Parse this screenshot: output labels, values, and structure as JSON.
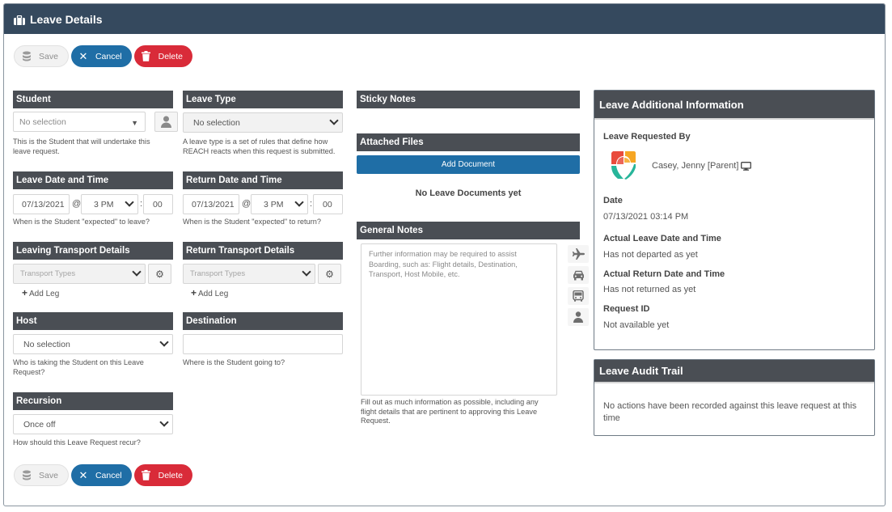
{
  "header": {
    "title": "Leave Details",
    "icon": "briefcase-icon"
  },
  "actions": {
    "save": "Save",
    "cancel": "Cancel",
    "delete": "Delete"
  },
  "student": {
    "heading": "Student",
    "value": "No selection",
    "help": "This is the Student that will undertake this leave request."
  },
  "leave_type": {
    "heading": "Leave Type",
    "value": "No selection",
    "help": "A leave type is a set of rules that define how REACH reacts when this request is submitted."
  },
  "leave_time": {
    "heading": "Leave Date and Time",
    "date": "07/13/2021",
    "at": "@",
    "hour": "3 PM",
    "sep": ":",
    "minute": "00",
    "help": "When is the Student \"expected\" to leave?"
  },
  "return_time": {
    "heading": "Return Date and Time",
    "date": "07/13/2021",
    "at": "@",
    "hour": "3 PM",
    "sep": ":",
    "minute": "00",
    "help": "When is the Student \"expected\" to return?"
  },
  "leaving_transport": {
    "heading": "Leaving Transport Details",
    "placeholder": "Transport Types",
    "add_leg": "Add Leg"
  },
  "return_transport": {
    "heading": "Return Transport Details",
    "placeholder": "Transport Types",
    "add_leg": "Add Leg"
  },
  "host": {
    "heading": "Host",
    "value": "No selection",
    "help": "Who is taking the Student on this Leave Request?"
  },
  "destination": {
    "heading": "Destination",
    "value": "",
    "help": "Where is the Student going to?"
  },
  "recursion": {
    "heading": "Recursion",
    "value": "Once off",
    "help": "How should this Leave Request recur?"
  },
  "sticky_notes": {
    "heading": "Sticky Notes"
  },
  "attached_files": {
    "heading": "Attached Files",
    "add_button": "Add Document",
    "empty": "No Leave Documents yet"
  },
  "general_notes": {
    "heading": "General Notes",
    "placeholder": "Further information may be required to assist Boarding, such as: Flight details, Destination, Transport, Host Mobile, etc.",
    "help": "Fill out as much information as possible, including any flight details that are pertinent to approving this Leave Request."
  },
  "additional_info": {
    "heading": "Leave Additional Information",
    "requested_by_label": "Leave Requested By",
    "requested_by_name": "Casey, Jenny [Parent]",
    "date_label": "Date",
    "date_value": "07/13/2021 03:14 PM",
    "actual_leave_label": "Actual Leave Date and Time",
    "actual_leave_value": "Has not departed as yet",
    "actual_return_label": "Actual Return Date and Time",
    "actual_return_value": "Has not returned as yet",
    "request_id_label": "Request ID",
    "request_id_value": "Not available yet",
    "logo_colors": [
      "#e94b3c",
      "#f6a623",
      "#27b59a"
    ]
  },
  "audit_trail": {
    "heading": "Leave Audit Trail",
    "empty": "No actions have been recorded against this leave request at this time"
  },
  "colors": {
    "header": "#35495e",
    "section": "#4a4e54",
    "primary": "#1f6ea6",
    "danger": "#d92b39"
  }
}
